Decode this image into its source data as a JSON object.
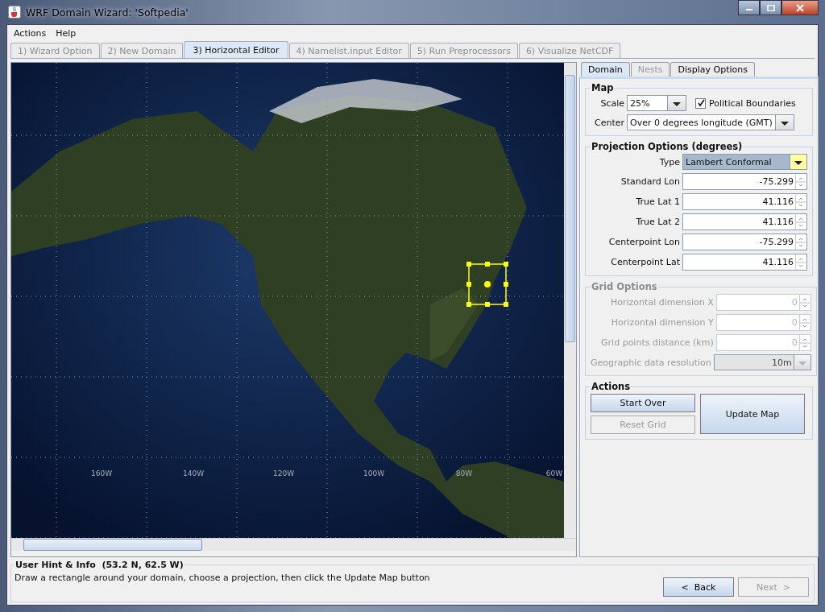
{
  "window": {
    "title": "WRF Domain Wizard: 'Softpedia'"
  },
  "menu": [
    "Actions",
    "Help"
  ],
  "tabs": [
    {
      "label": "1) Wizard Option",
      "selected": false,
      "disabled": true
    },
    {
      "label": "2) New Domain",
      "selected": false,
      "disabled": true
    },
    {
      "label": "3) Horizontal Editor",
      "selected": true,
      "disabled": false
    },
    {
      "label": "4) Namelist.input Editor",
      "selected": false,
      "disabled": true
    },
    {
      "label": "5) Run Preprocessors",
      "selected": false,
      "disabled": true
    },
    {
      "label": "6) Visualize NetCDF",
      "selected": false,
      "disabled": true
    }
  ],
  "map": {
    "longitude_labels": [
      "160W",
      "140W",
      "120W",
      "100W",
      "80W",
      "60W"
    ]
  },
  "panel": {
    "tabs": [
      {
        "label": "Domain",
        "selected": true,
        "disabled": false
      },
      {
        "label": "Nests",
        "selected": false,
        "disabled": true
      },
      {
        "label": "Display Options",
        "selected": false,
        "disabled": false
      }
    ],
    "map_group": {
      "title": "Map",
      "scale_label": "Scale",
      "scale": "25%",
      "boundaries": {
        "label": "Political Boundaries",
        "checked": true
      },
      "center_label": "Center",
      "center": "Over 0 degrees longitude (GMT)"
    },
    "projection": {
      "title": "Projection Options (degrees)",
      "type_label": "Type",
      "type": "Lambert Conformal",
      "fields": [
        {
          "label": "Standard Lon",
          "value": "-75.299"
        },
        {
          "label": "True Lat 1",
          "value": "41.116"
        },
        {
          "label": "True Lat 2",
          "value": "41.116"
        },
        {
          "label": "Centerpoint Lon",
          "value": "-75.299"
        },
        {
          "label": "Centerpoint Lat",
          "value": "41.116"
        }
      ]
    },
    "grid": {
      "title": "Grid Options",
      "disabled": true,
      "fields": [
        {
          "kind": "spinner",
          "label": "Horizontal dimension X",
          "value": "0"
        },
        {
          "kind": "spinner",
          "label": "Horizontal dimension Y",
          "value": "0"
        },
        {
          "kind": "spinner",
          "label": "Grid points distance (km)",
          "value": "0"
        },
        {
          "kind": "dropdown",
          "label": "Geographic data resolution",
          "value": "10m"
        }
      ]
    },
    "actions": {
      "title": "Actions",
      "buttons": [
        {
          "label": "Start Over",
          "disabled": false
        },
        {
          "label": "Reset Grid",
          "disabled": true
        },
        {
          "label": "Update Map",
          "disabled": false
        }
      ]
    }
  },
  "hint": {
    "title": "User Hint & Info  (53.2 N, 62.5 W)",
    "text": "Draw a rectangle around your domain, choose a projection, then click the Update Map button"
  },
  "nav": [
    {
      "label": "<  Back",
      "disabled": false
    },
    {
      "label": "Next  >",
      "disabled": true
    }
  ]
}
